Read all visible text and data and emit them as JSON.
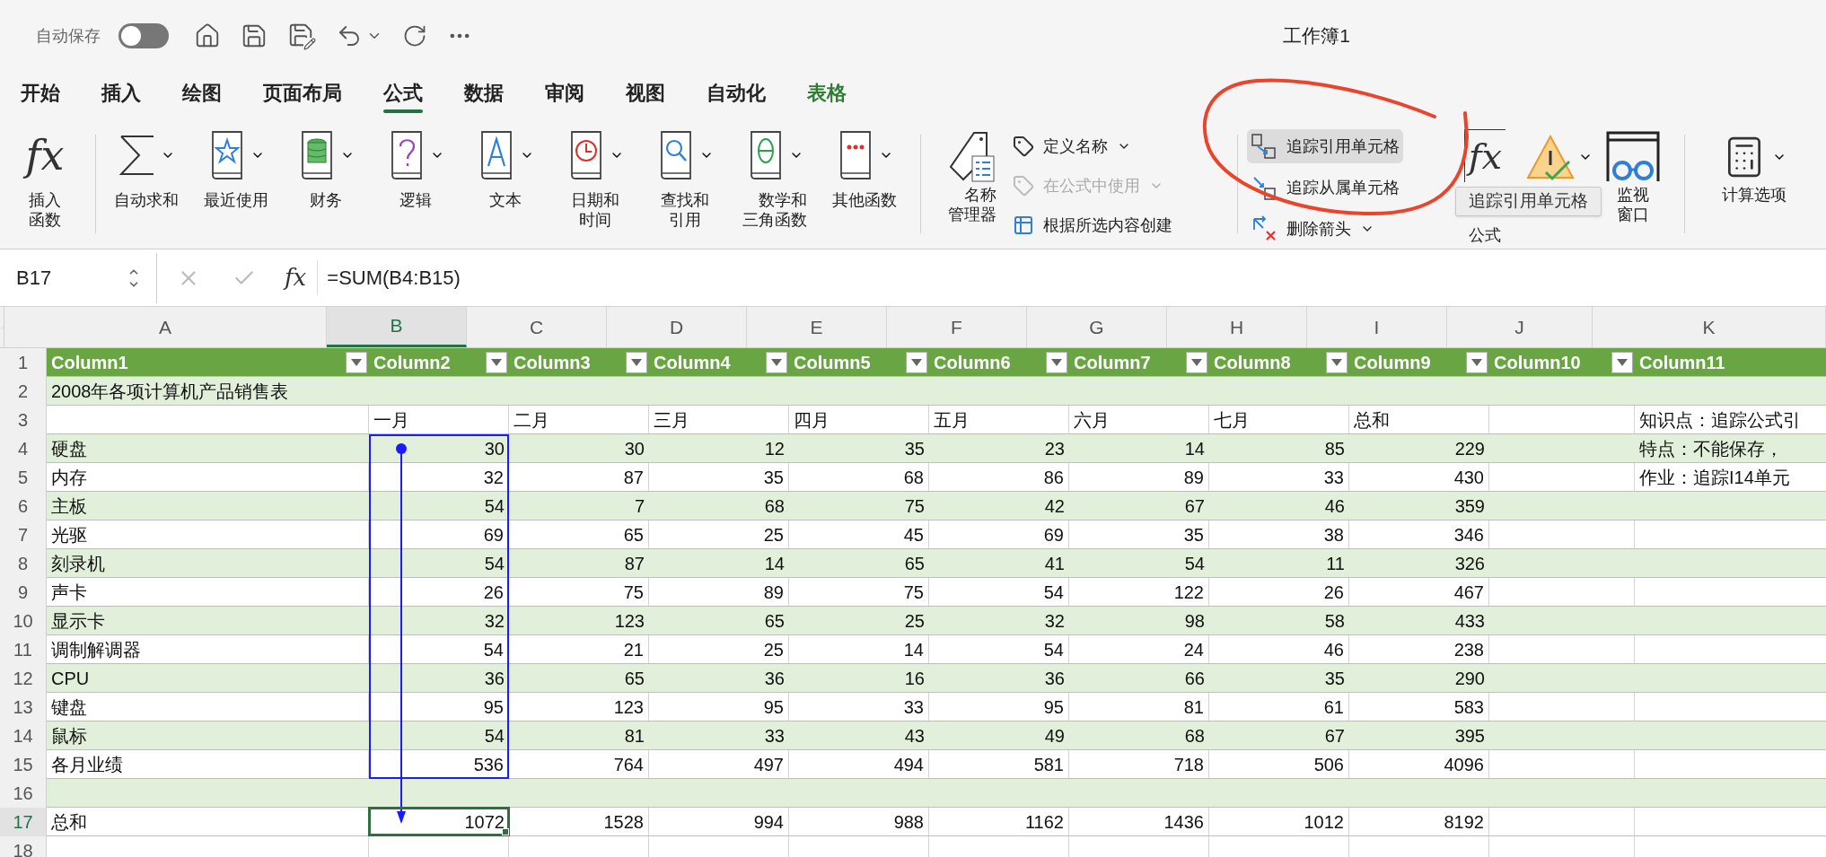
{
  "title_bar": {
    "autosave_label": "自动保存",
    "autosave_on": false,
    "title": "工作簿1"
  },
  "tabs": [
    {
      "label": "开始",
      "selected": false,
      "contextual": false
    },
    {
      "label": "插入",
      "selected": false,
      "contextual": false
    },
    {
      "label": "绘图",
      "selected": false,
      "contextual": false
    },
    {
      "label": "页面布局",
      "selected": false,
      "contextual": false
    },
    {
      "label": "公式",
      "selected": true,
      "contextual": false
    },
    {
      "label": "数据",
      "selected": false,
      "contextual": false
    },
    {
      "label": "审阅",
      "selected": false,
      "contextual": false
    },
    {
      "label": "视图",
      "selected": false,
      "contextual": false
    },
    {
      "label": "自动化",
      "selected": false,
      "contextual": false
    },
    {
      "label": "表格",
      "selected": false,
      "contextual": true
    }
  ],
  "ribbon": {
    "insert_function": {
      "icon_text": "fx",
      "label": "插入函数"
    },
    "function_library": [
      {
        "kind": "sigma",
        "label": "自动求和"
      },
      {
        "kind": "star",
        "label": "最近使用"
      },
      {
        "kind": "database",
        "label": "财务"
      },
      {
        "kind": "question",
        "label": "逻辑"
      },
      {
        "kind": "letter",
        "label": "文本"
      },
      {
        "kind": "clock",
        "label": "日期和时间"
      },
      {
        "kind": "magnifier",
        "label": "查找和引用"
      },
      {
        "kind": "theta",
        "label": "数学和三角函数"
      },
      {
        "kind": "dots",
        "label": "其他函数"
      }
    ],
    "name_manager": {
      "label": "名称管理器"
    },
    "names": [
      {
        "kind": "tag",
        "label": "定义名称",
        "disabled": false,
        "dropdown": true
      },
      {
        "kind": "tagfx",
        "label": "在公式中使用",
        "disabled": true,
        "dropdown": true
      },
      {
        "kind": "table",
        "label": "根据所选内容创建",
        "disabled": false,
        "dropdown": false
      }
    ],
    "auditing": [
      {
        "kind": "precedents",
        "label": "追踪引用单元格",
        "highlighted": true,
        "dropdown": false
      },
      {
        "kind": "dependents",
        "label": "追踪从属单元格",
        "highlighted": false,
        "dropdown": false
      },
      {
        "kind": "remove",
        "label": "删除箭头",
        "highlighted": false,
        "dropdown": true
      }
    ],
    "show_formulas": {
      "icon_text": "fx",
      "label": "公式"
    },
    "watch_window": {
      "label": "监视窗口"
    },
    "calc_options": {
      "label": "计算选项"
    }
  },
  "tooltip": "追踪引用单元格",
  "annotation": {
    "circle": true
  },
  "formula_bar": {
    "name_box": "B17",
    "fx": "fx",
    "formula": "=SUM(B4:B15)"
  },
  "sheet": {
    "precedent_arrow": true,
    "columns": [
      {
        "label": "A",
        "selected": false,
        "filter_button": true
      },
      {
        "label": "B",
        "selected": true,
        "filter_button": true
      },
      {
        "label": "C",
        "selected": false,
        "filter_button": true
      },
      {
        "label": "D",
        "selected": false,
        "filter_button": true
      },
      {
        "label": "E",
        "selected": false,
        "filter_button": true
      },
      {
        "label": "F",
        "selected": false,
        "filter_button": true
      },
      {
        "label": "G",
        "selected": false,
        "filter_button": true
      },
      {
        "label": "H",
        "selected": false,
        "filter_button": true
      },
      {
        "label": "I",
        "selected": false,
        "filter_button": true
      },
      {
        "label": "J",
        "selected": false,
        "filter_button": true
      },
      {
        "label": "K",
        "selected": false,
        "filter_button": false
      }
    ],
    "rows": [
      {
        "number": "1",
        "kind": "header",
        "band": false,
        "selected": false,
        "cells": {
          "A": "Column1",
          "B": "Column2",
          "C": "Column3",
          "D": "Column4",
          "E": "Column5",
          "F": "Column6",
          "G": "Column7",
          "H": "Column8",
          "I": "Column9",
          "J": "Column10",
          "K": "Column11"
        }
      },
      {
        "number": "2",
        "kind": "title",
        "band": true,
        "selected": false,
        "cells": {
          "A": "2008年各项计算机产品销售表"
        }
      },
      {
        "number": "3",
        "kind": "labels",
        "band": false,
        "selected": false,
        "cells": {
          "B": "一月",
          "C": "二月",
          "D": "三月",
          "E": "四月",
          "F": "五月",
          "G": "六月",
          "H": "七月",
          "I": "总和",
          "K": "知识点：追踪公式引"
        }
      },
      {
        "number": "4",
        "kind": "data",
        "band": true,
        "selected": false,
        "cells": {
          "A": "硬盘",
          "B": "30",
          "C": "30",
          "D": "12",
          "E": "35",
          "F": "23",
          "G": "14",
          "H": "85",
          "I": "229",
          "K": "特点：不能保存，"
        }
      },
      {
        "number": "5",
        "kind": "data",
        "band": false,
        "selected": false,
        "cells": {
          "A": "内存",
          "B": "32",
          "C": "87",
          "D": "35",
          "E": "68",
          "F": "86",
          "G": "89",
          "H": "33",
          "I": "430",
          "K": "作业：追踪I14单元"
        }
      },
      {
        "number": "6",
        "kind": "data",
        "band": true,
        "selected": false,
        "cells": {
          "A": "主板",
          "B": "54",
          "C": "7",
          "D": "68",
          "E": "75",
          "F": "42",
          "G": "67",
          "H": "46",
          "I": "359"
        }
      },
      {
        "number": "7",
        "kind": "data",
        "band": false,
        "selected": false,
        "cells": {
          "A": "光驱",
          "B": "69",
          "C": "65",
          "D": "25",
          "E": "45",
          "F": "69",
          "G": "35",
          "H": "38",
          "I": "346"
        }
      },
      {
        "number": "8",
        "kind": "data",
        "band": true,
        "selected": false,
        "cells": {
          "A": "刻录机",
          "B": "54",
          "C": "87",
          "D": "14",
          "E": "65",
          "F": "41",
          "G": "54",
          "H": "11",
          "I": "326"
        }
      },
      {
        "number": "9",
        "kind": "data",
        "band": false,
        "selected": false,
        "cells": {
          "A": "声卡",
          "B": "26",
          "C": "75",
          "D": "89",
          "E": "75",
          "F": "54",
          "G": "122",
          "H": "26",
          "I": "467"
        }
      },
      {
        "number": "10",
        "kind": "data",
        "band": true,
        "selected": false,
        "cells": {
          "A": "显示卡",
          "B": "32",
          "C": "123",
          "D": "65",
          "E": "25",
          "F": "32",
          "G": "98",
          "H": "58",
          "I": "433"
        }
      },
      {
        "number": "11",
        "kind": "data",
        "band": false,
        "selected": false,
        "cells": {
          "A": "调制解调器",
          "B": "54",
          "C": "21",
          "D": "25",
          "E": "14",
          "F": "54",
          "G": "24",
          "H": "46",
          "I": "238"
        }
      },
      {
        "number": "12",
        "kind": "data",
        "band": true,
        "selected": false,
        "cells": {
          "A": "CPU",
          "B": "36",
          "C": "65",
          "D": "36",
          "E": "16",
          "F": "36",
          "G": "66",
          "H": "35",
          "I": "290"
        }
      },
      {
        "number": "13",
        "kind": "data",
        "band": false,
        "selected": false,
        "cells": {
          "A": "键盘",
          "B": "95",
          "C": "123",
          "D": "95",
          "E": "33",
          "F": "95",
          "G": "81",
          "H": "61",
          "I": "583"
        }
      },
      {
        "number": "14",
        "kind": "data",
        "band": true,
        "selected": false,
        "cells": {
          "A": "鼠标",
          "B": "54",
          "C": "81",
          "D": "33",
          "E": "43",
          "F": "49",
          "G": "68",
          "H": "67",
          "I": "395"
        }
      },
      {
        "number": "15",
        "kind": "data",
        "band": false,
        "selected": false,
        "cells": {
          "A": "各月业绩",
          "B": "536",
          "C": "764",
          "D": "497",
          "E": "494",
          "F": "581",
          "G": "718",
          "H": "506",
          "I": "4096"
        }
      },
      {
        "number": "16",
        "kind": "data",
        "band": true,
        "selected": false,
        "cells": {}
      },
      {
        "number": "17",
        "kind": "data",
        "band": false,
        "selected": true,
        "cells": {
          "A": "总和",
          "B": "1072",
          "C": "1528",
          "D": "994",
          "E": "988",
          "F": "1162",
          "G": "1436",
          "H": "1012",
          "I": "8192"
        }
      },
      {
        "number": "18",
        "kind": "outside",
        "band": false,
        "selected": false,
        "cells": {}
      }
    ]
  }
}
